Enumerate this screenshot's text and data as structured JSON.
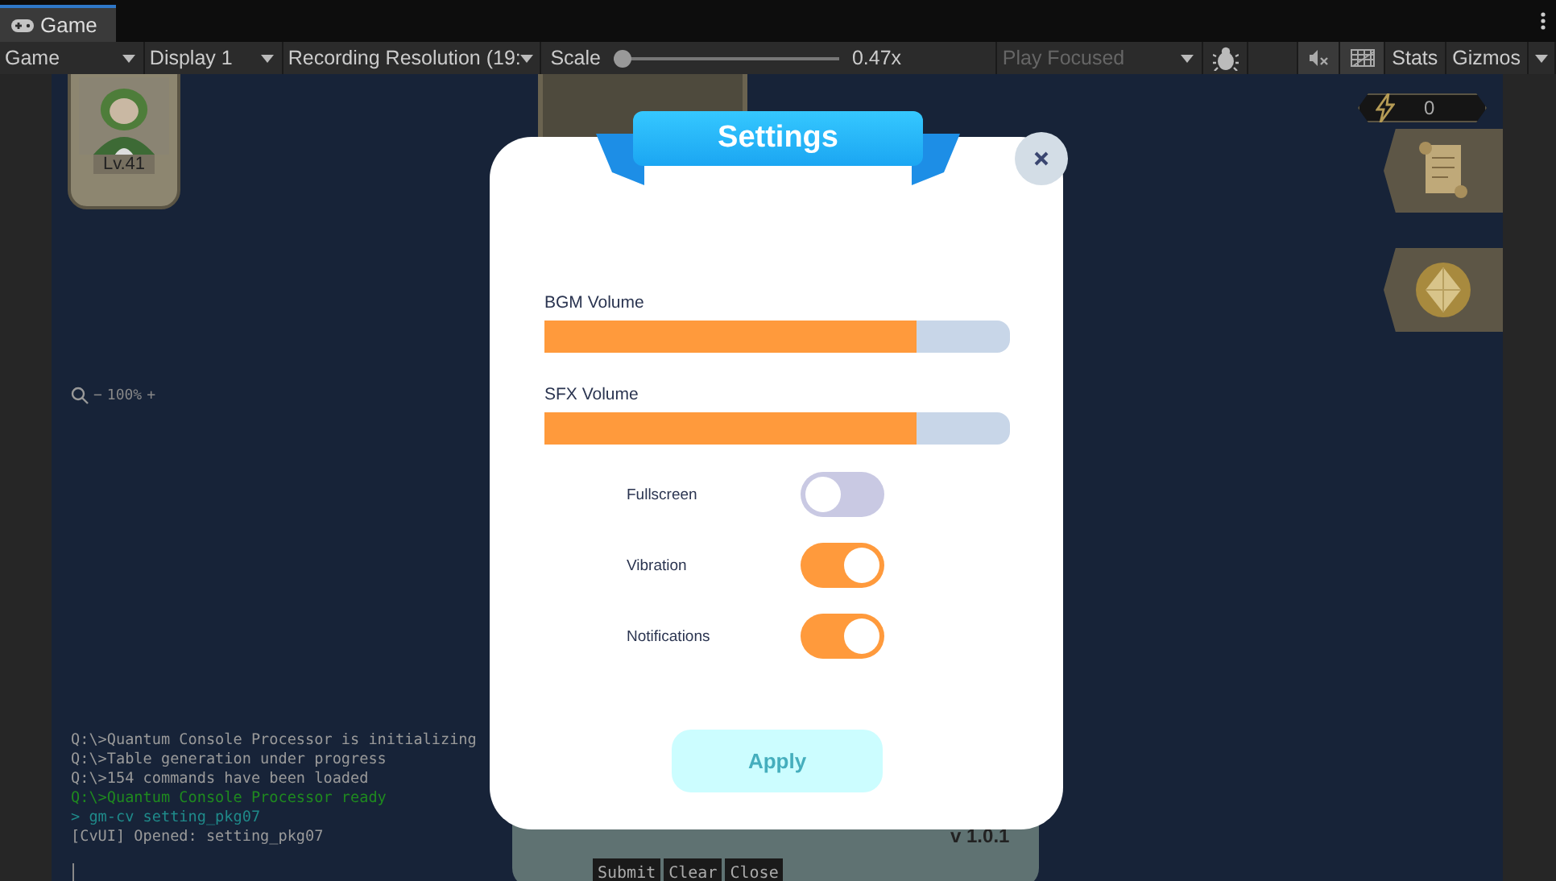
{
  "tabs": [
    {
      "label": "Game",
      "selected": true
    }
  ],
  "toolbar": {
    "view_dropdown": "Game",
    "display_dropdown": "Display 1",
    "resolution_dropdown": "Recording Resolution (19:",
    "scale": {
      "label": "Scale",
      "level": 0,
      "reading": "0.47x"
    },
    "play_mode": {
      "label": "Play Focused",
      "disabled": true
    },
    "stats": "Stats",
    "gizmos": "Gizmos"
  },
  "game_view": {
    "player_card": {
      "level": "Lv.41"
    },
    "zoom_control": {
      "minus": "−",
      "value": "100%",
      "plus": "+"
    },
    "energy": "0",
    "version": "v 1.0.1",
    "console": {
      "lines": [
        {
          "kind": "info",
          "text": "Q:\\>Quantum Console Processor is initializing"
        },
        {
          "kind": "info",
          "text": "Q:\\>Table generation under progress"
        },
        {
          "kind": "info",
          "text": "Q:\\>154 commands have been loaded"
        },
        {
          "kind": "success",
          "text": "Q:\\>Quantum Console Processor ready"
        },
        {
          "kind": "command",
          "text": "> gm-cv setting_pkg07"
        },
        {
          "kind": "info",
          "text": "[CvUI] Opened: setting_pkg07"
        }
      ],
      "buttons": [
        "Submit",
        "Clear",
        "Close"
      ]
    }
  },
  "settings_dialog": {
    "title": "Settings",
    "sliders": [
      {
        "label": "BGM Volume",
        "level": 0.8
      },
      {
        "label": "SFX Volume",
        "level": 0.8
      }
    ],
    "toggles": [
      {
        "label": "Fullscreen",
        "on": false
      },
      {
        "label": "Vibration",
        "on": true
      },
      {
        "label": "Notifications",
        "on": true
      }
    ],
    "apply_button": {
      "label": "Apply",
      "disabled": true
    }
  }
}
